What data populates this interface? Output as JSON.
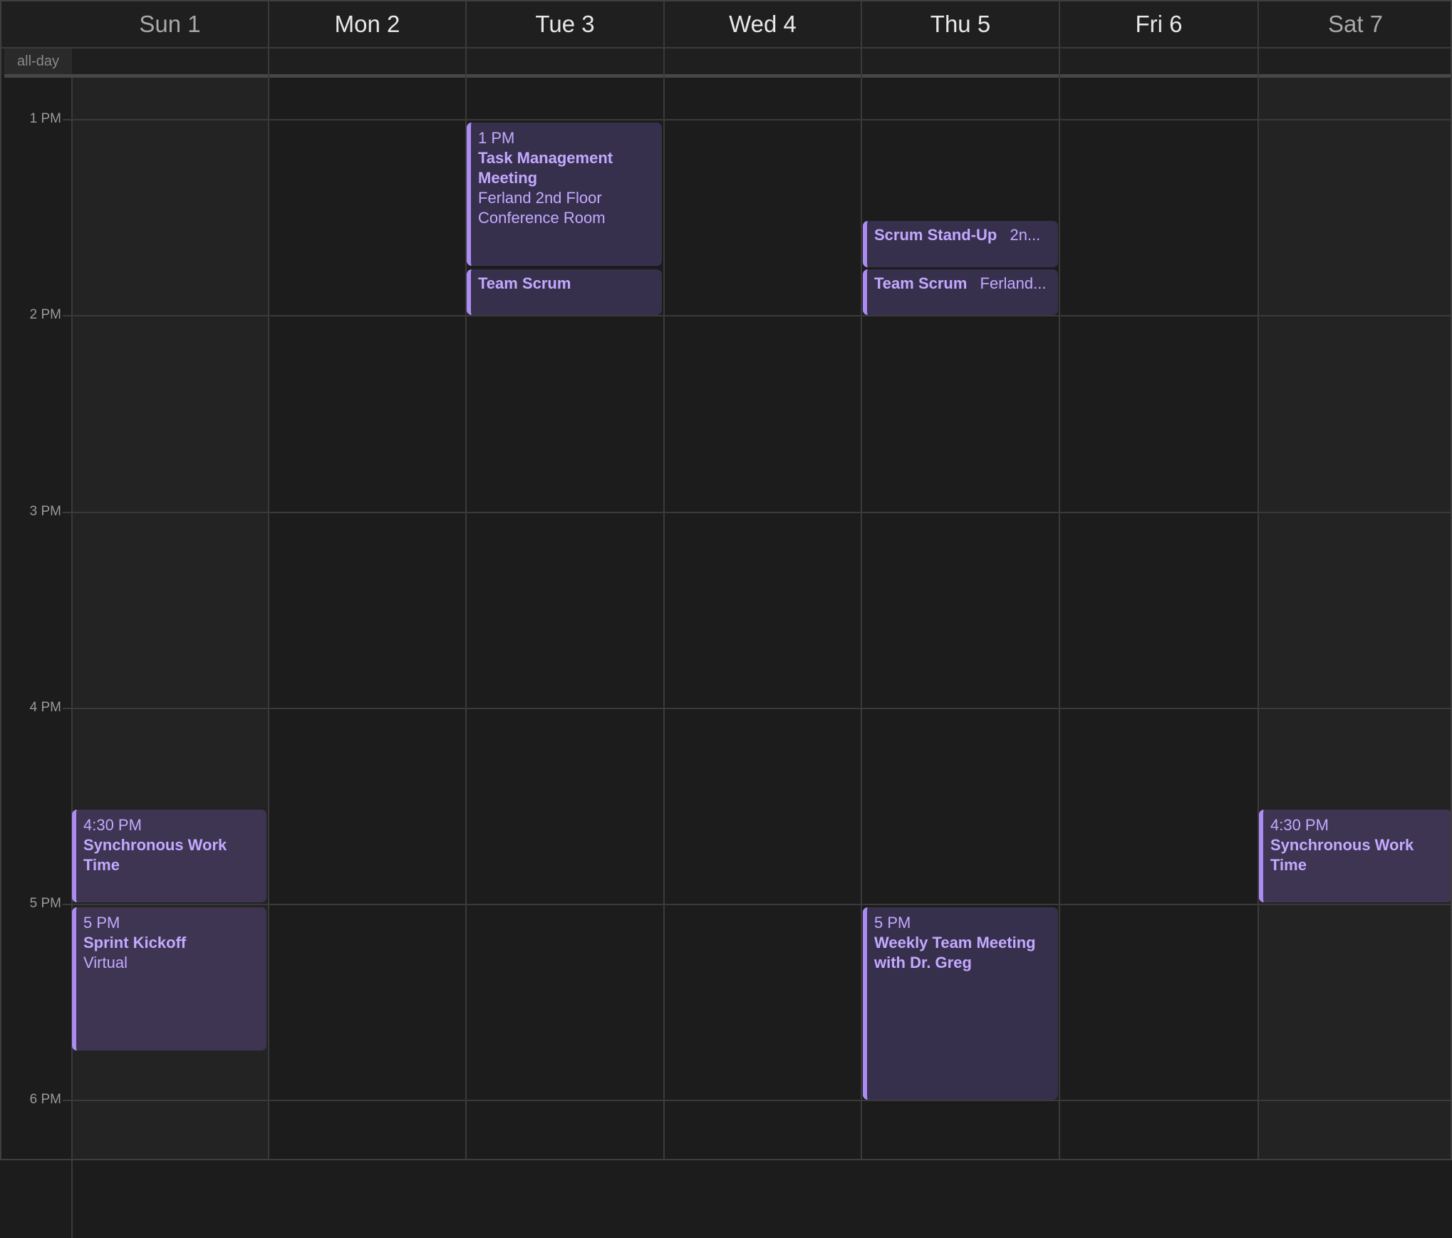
{
  "header": {
    "days": [
      {
        "label": "Sun 1"
      },
      {
        "label": "Mon 2"
      },
      {
        "label": "Tue 3"
      },
      {
        "label": "Wed 4"
      },
      {
        "label": "Thu 5"
      },
      {
        "label": "Fri 6"
      },
      {
        "label": "Sat 7"
      }
    ]
  },
  "allday": {
    "label": "all-day"
  },
  "time_labels": [
    "1 PM",
    "2 PM",
    "3 PM",
    "4 PM",
    "5 PM",
    "6 PM"
  ],
  "colors": {
    "background": "#1c1c1c",
    "weekend_background": "#232323",
    "event_background": "#37304d",
    "event_accent": "#ab8cf2",
    "event_text": "#c3a9ff"
  },
  "events": [
    {
      "time": "1 PM",
      "title": "Task Management Meeting",
      "location": "Ferland 2nd Floor Conference Room"
    },
    {
      "title": "Team Scrum"
    },
    {
      "title": "Scrum Stand-Up",
      "location": "2n..."
    },
    {
      "title": "Team Scrum",
      "location": "Ferland..."
    },
    {
      "time": "4:30 PM",
      "title": "Synchronous Work Time"
    },
    {
      "time": "5 PM",
      "title": "Sprint Kickoff",
      "location": "Virtual"
    },
    {
      "time": "5 PM",
      "title": "Weekly Team Meeting with Dr. Greg"
    },
    {
      "time": "4:30 PM",
      "title": "Synchronous Work Time"
    }
  ]
}
